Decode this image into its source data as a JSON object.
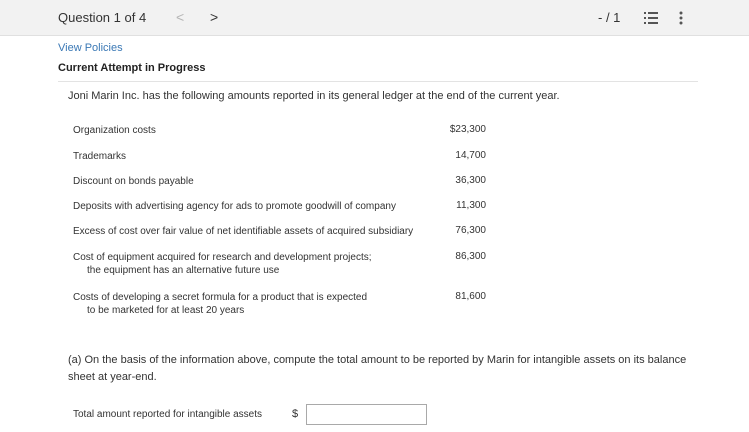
{
  "header": {
    "question_counter": "Question 1 of 4",
    "prev_glyph": "<",
    "next_glyph": ">",
    "score": "- / 1",
    "icons": [
      "list-icon",
      "more-vertical-icon"
    ]
  },
  "view_policies": "View Policies",
  "attempt_title": "Current Attempt in Progress",
  "intro": "Joni Marin Inc. has the following amounts reported in its general ledger at the end of the current year.",
  "ledger": [
    {
      "label": "Organization costs",
      "label2": "",
      "value": "$23,300"
    },
    {
      "label": "Trademarks",
      "label2": "",
      "value": "14,700"
    },
    {
      "label": "Discount on bonds payable",
      "label2": "",
      "value": "36,300"
    },
    {
      "label": "Deposits with advertising agency for ads to promote goodwill of company",
      "label2": "",
      "value": "11,300"
    },
    {
      "label": "Excess of cost over fair value of net identifiable assets of acquired subsidiary",
      "label2": "",
      "value": "76,300"
    },
    {
      "label": "Cost of equipment acquired for research and development projects;",
      "label2": "the equipment has an alternative future use",
      "value": "86,300"
    },
    {
      "label": "Costs of developing a secret formula for a product that is expected",
      "label2": "to be marketed for at least 20 years",
      "value": "81,600"
    }
  ],
  "part_a": "(a) On the basis of the information above, compute the total amount to be reported by Marin for intangible assets on its balance sheet at year-end.",
  "answer": {
    "label": "Total amount reported for intangible assets",
    "currency": "$",
    "value": ""
  }
}
